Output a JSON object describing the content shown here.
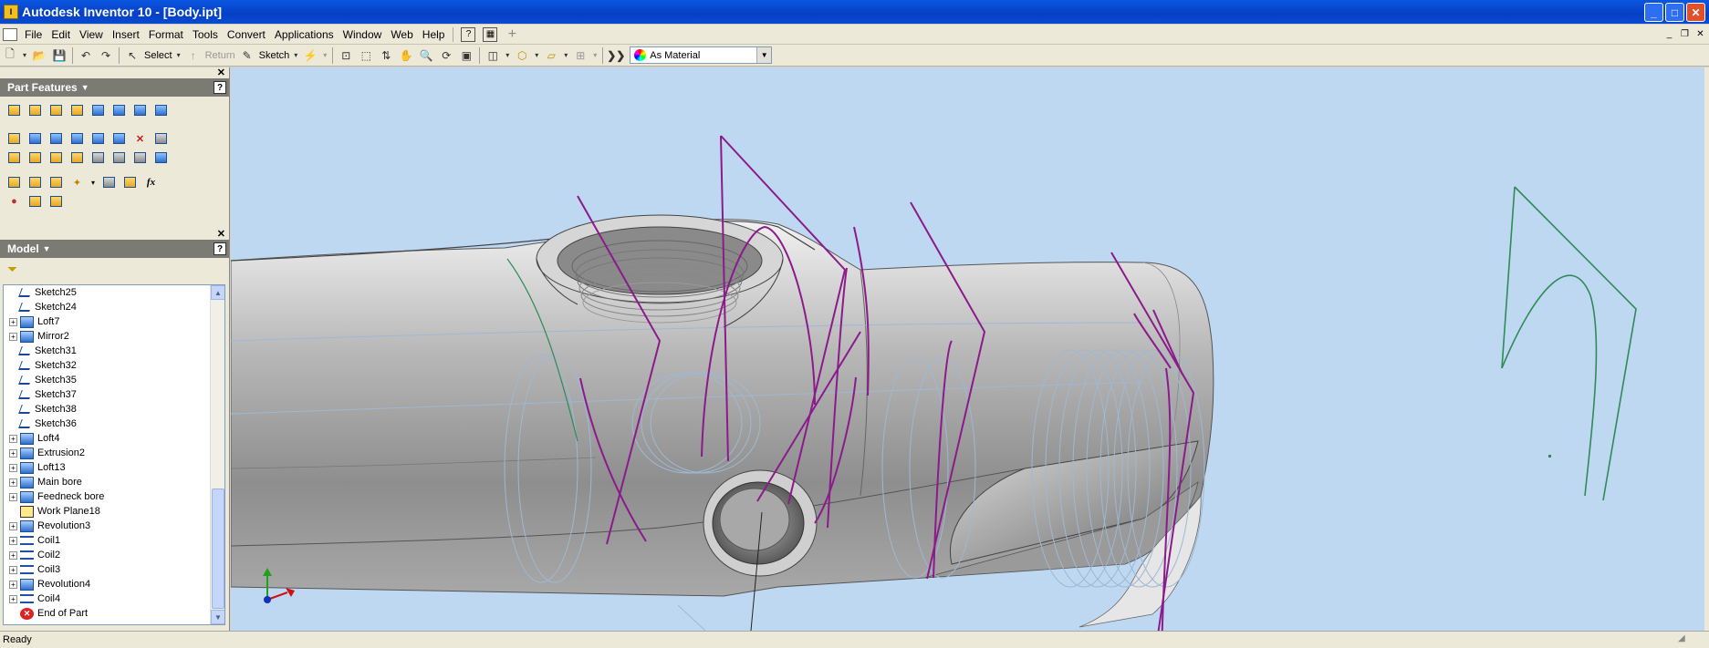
{
  "window": {
    "title": "Autodesk Inventor 10 - [Body.ipt]",
    "app_icon": "inventor-icon"
  },
  "menu": [
    "File",
    "Edit",
    "View",
    "Insert",
    "Format",
    "Tools",
    "Convert",
    "Applications",
    "Window",
    "Web",
    "Help"
  ],
  "toolbar": {
    "select_label": "Select",
    "return_label": "Return",
    "sketch_label": "Sketch",
    "material": "As Material"
  },
  "part_features": {
    "title": "Part Features"
  },
  "model": {
    "title": "Model",
    "items": [
      {
        "label": "Sketch25",
        "type": "sketch",
        "expand": false
      },
      {
        "label": "Sketch24",
        "type": "sketch",
        "expand": false
      },
      {
        "label": "Loft7",
        "type": "solid",
        "expand": true
      },
      {
        "label": "Mirror2",
        "type": "solid",
        "expand": true
      },
      {
        "label": "Sketch31",
        "type": "sketch",
        "expand": false
      },
      {
        "label": "Sketch32",
        "type": "sketch",
        "expand": false
      },
      {
        "label": "Sketch35",
        "type": "sketch",
        "expand": false
      },
      {
        "label": "Sketch37",
        "type": "sketch",
        "expand": false
      },
      {
        "label": "Sketch38",
        "type": "sketch",
        "expand": false
      },
      {
        "label": "Sketch36",
        "type": "sketch",
        "expand": false
      },
      {
        "label": "Loft4",
        "type": "solid",
        "expand": true
      },
      {
        "label": "Extrusion2",
        "type": "solid",
        "expand": true
      },
      {
        "label": "Loft13",
        "type": "solid",
        "expand": true
      },
      {
        "label": "Main bore",
        "type": "solid",
        "expand": true
      },
      {
        "label": "Feedneck bore",
        "type": "solid",
        "expand": true
      },
      {
        "label": "Work Plane18",
        "type": "plane",
        "expand": false
      },
      {
        "label": "Revolution3",
        "type": "solid",
        "expand": true
      },
      {
        "label": "Coil1",
        "type": "coil",
        "expand": true
      },
      {
        "label": "Coil2",
        "type": "coil",
        "expand": true
      },
      {
        "label": "Coil3",
        "type": "coil",
        "expand": true
      },
      {
        "label": "Revolution4",
        "type": "solid",
        "expand": true
      },
      {
        "label": "Coil4",
        "type": "coil",
        "expand": true
      },
      {
        "label": "End of Part",
        "type": "end",
        "expand": false
      }
    ]
  },
  "status": {
    "text": "Ready"
  },
  "colors": {
    "viewport_bg": "#bfd8f2",
    "sketch_purple": "#8b1a8b",
    "sketch_green": "#2e8b57",
    "title_blue": "#0a56e0"
  }
}
